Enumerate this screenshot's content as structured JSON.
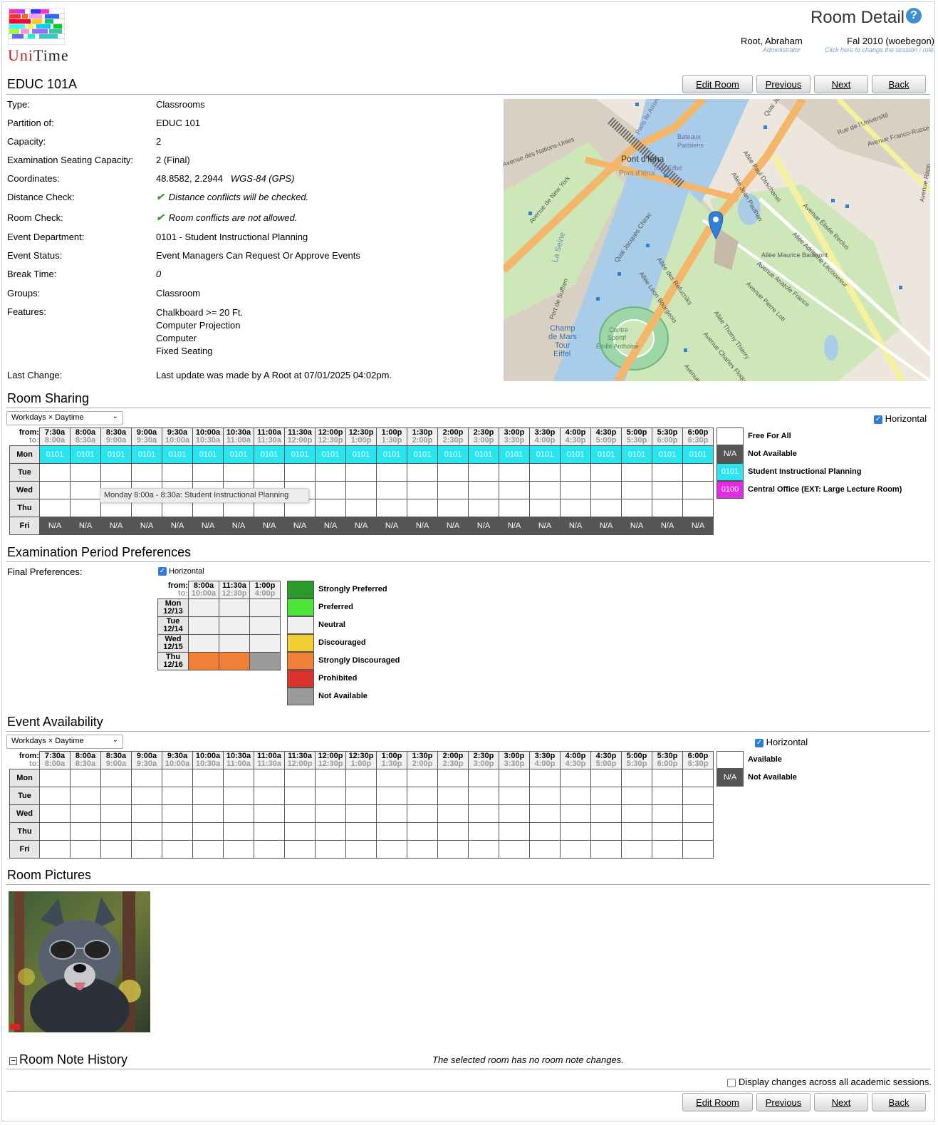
{
  "header": {
    "title": "Room Detail",
    "help_icon": "?",
    "user_name": "Root, Abraham",
    "user_role": "Administrator",
    "session": "Fal 2010 (woebegon)",
    "session_hint": "Click here to change the session / role."
  },
  "logo": {
    "text_first": "Uni",
    "text_second": "Time"
  },
  "room": {
    "name": "EDUC 101A"
  },
  "buttons": {
    "edit": "Edit Room",
    "previous": "Previous",
    "next": "Next",
    "back": "Back"
  },
  "details": {
    "type_label": "Type:",
    "type": "Classrooms",
    "partition_label": "Partition of:",
    "partition": "EDUC 101",
    "capacity_label": "Capacity:",
    "capacity": "2",
    "exam_cap_label": "Examination Seating Capacity:",
    "exam_cap": "2 (Final)",
    "coords_label": "Coordinates:",
    "coords": "48.8582, 2.2944",
    "coords_system": "WGS-84 (GPS)",
    "distance_label": "Distance Check:",
    "distance": "Distance conflicts will be checked.",
    "roomcheck_label": "Room Check:",
    "roomcheck": "Room conflicts are not allowed.",
    "evdept_label": "Event Department:",
    "evdept": "0101 - Student Instructional Planning",
    "evstatus_label": "Event Status:",
    "evstatus": "Event Managers Can Request Or Approve Events",
    "break_label": "Break Time:",
    "break": "0",
    "groups_label": "Groups:",
    "groups": "Classroom",
    "features_label": "Features:",
    "features": [
      "Chalkboard >= 20 Ft.",
      "Computer Projection",
      "Computer",
      "Fixed Seating"
    ],
    "lastchange_label": "Last Change:",
    "lastchange": "Last update was made by A Root at 07/01/2025 04:02pm."
  },
  "map": {
    "labels": [
      "Quai Jacques Chirac",
      "Avenue de New York",
      "Pont d'Iéna",
      "Pont d'Iéna",
      "La Seine",
      "Champ de Mars Tour Eiffel",
      "Centre Sportif Émile Anthoine",
      "Avenue des Nations-Unies",
      "Bateaux Parisiens",
      "Tour Eiffel",
      "Allée Paul Deschanel",
      "Allée Jean Paulhan",
      "Avenue Élisée Reclus",
      "Allée Adrienne Lecouvreur",
      "Allée Maurice Baumont",
      "Avenue Anatole France",
      "Avenue Pierre Loti",
      "Allée Thomy Thierry",
      "Avenue Charles Floquet",
      "Allée des Refuzniks",
      "Allée Léon Bourgeois",
      "Port de Suffren",
      "Rue de l'Université",
      "Avenue Franco-Russe",
      "Avenue Rapp",
      "Paris Île Arrondi",
      "Quai Jacq",
      "Avenue de"
    ]
  },
  "room_sharing": {
    "title": "Room Sharing",
    "select": "Workdays × Daytime",
    "horizontal_label": "Horizontal",
    "from_label": "from:",
    "to_label": "to:",
    "times_from": [
      "7:30a",
      "8:00a",
      "8:30a",
      "9:00a",
      "9:30a",
      "10:00a",
      "10:30a",
      "11:00a",
      "11:30a",
      "12:00p",
      "12:30p",
      "1:00p",
      "1:30p",
      "2:00p",
      "2:30p",
      "3:00p",
      "3:30p",
      "4:00p",
      "4:30p",
      "5:00p",
      "5:30p",
      "6:00p"
    ],
    "times_to": [
      "8:00a",
      "8:30a",
      "9:00a",
      "9:30a",
      "10:00a",
      "10:30a",
      "11:00a",
      "11:30a",
      "12:00p",
      "12:30p",
      "1:00p",
      "1:30p",
      "2:00p",
      "2:30p",
      "3:00p",
      "3:30p",
      "4:00p",
      "4:30p",
      "5:00p",
      "5:30p",
      "6:00p",
      "6:30p"
    ],
    "days": [
      "Mon",
      "Tue",
      "Wed",
      "Thu",
      "Fri"
    ],
    "cell_code": "0101",
    "na": "N/A",
    "tooltip": "Monday 8:00a - 8:30a: Student Instructional Planning",
    "legend": [
      {
        "code": "",
        "label": "Free For All",
        "color": "#ffffff"
      },
      {
        "code": "N/A",
        "label": "Not Available",
        "color": "#555555"
      },
      {
        "code": "0101",
        "label": "Student Instructional Planning",
        "color": "#28e5f0"
      },
      {
        "code": "0100",
        "label": "Central Office (EXT: Large Lecture Room)",
        "color": "#e52ae5"
      }
    ]
  },
  "exam": {
    "title": "Examination Period Preferences",
    "final_label": "Final Preferences:",
    "horizontal_label": "Horizontal",
    "from_label": "from:",
    "to_label": "to:",
    "times_from": [
      "8:00a",
      "11:30a",
      "1:00p"
    ],
    "times_to": [
      "10:00a",
      "12:30p",
      "4:00p"
    ],
    "days": [
      {
        "d": "Mon",
        "dt": "12/13"
      },
      {
        "d": "Tue",
        "dt": "12/14"
      },
      {
        "d": "Wed",
        "dt": "12/15"
      },
      {
        "d": "Thu",
        "dt": "12/16"
      }
    ],
    "legend": [
      {
        "label": "Strongly Preferred",
        "color": "#2a9b2a"
      },
      {
        "label": "Preferred",
        "color": "#4ee53a"
      },
      {
        "label": "Neutral",
        "color": "#f0f0f0"
      },
      {
        "label": "Discouraged",
        "color": "#f2cf32"
      },
      {
        "label": "Strongly Discouraged",
        "color": "#f08038"
      },
      {
        "label": "Prohibited",
        "color": "#d9342b"
      },
      {
        "label": "Not Available",
        "color": "#9b9b9b"
      }
    ]
  },
  "event_availability": {
    "title": "Event Availability",
    "select": "Workdays × Daytime",
    "horizontal_label": "Horizontal",
    "legend": [
      {
        "code": "",
        "label": "Available"
      },
      {
        "code": "N/A",
        "label": "Not Available"
      }
    ]
  },
  "pictures": {
    "title": "Room Pictures"
  },
  "note_history": {
    "title": "Room Note History",
    "toggle": "−",
    "empty": "The selected room has no room note changes.",
    "all_sessions_label": "Display changes across all academic sessions."
  }
}
